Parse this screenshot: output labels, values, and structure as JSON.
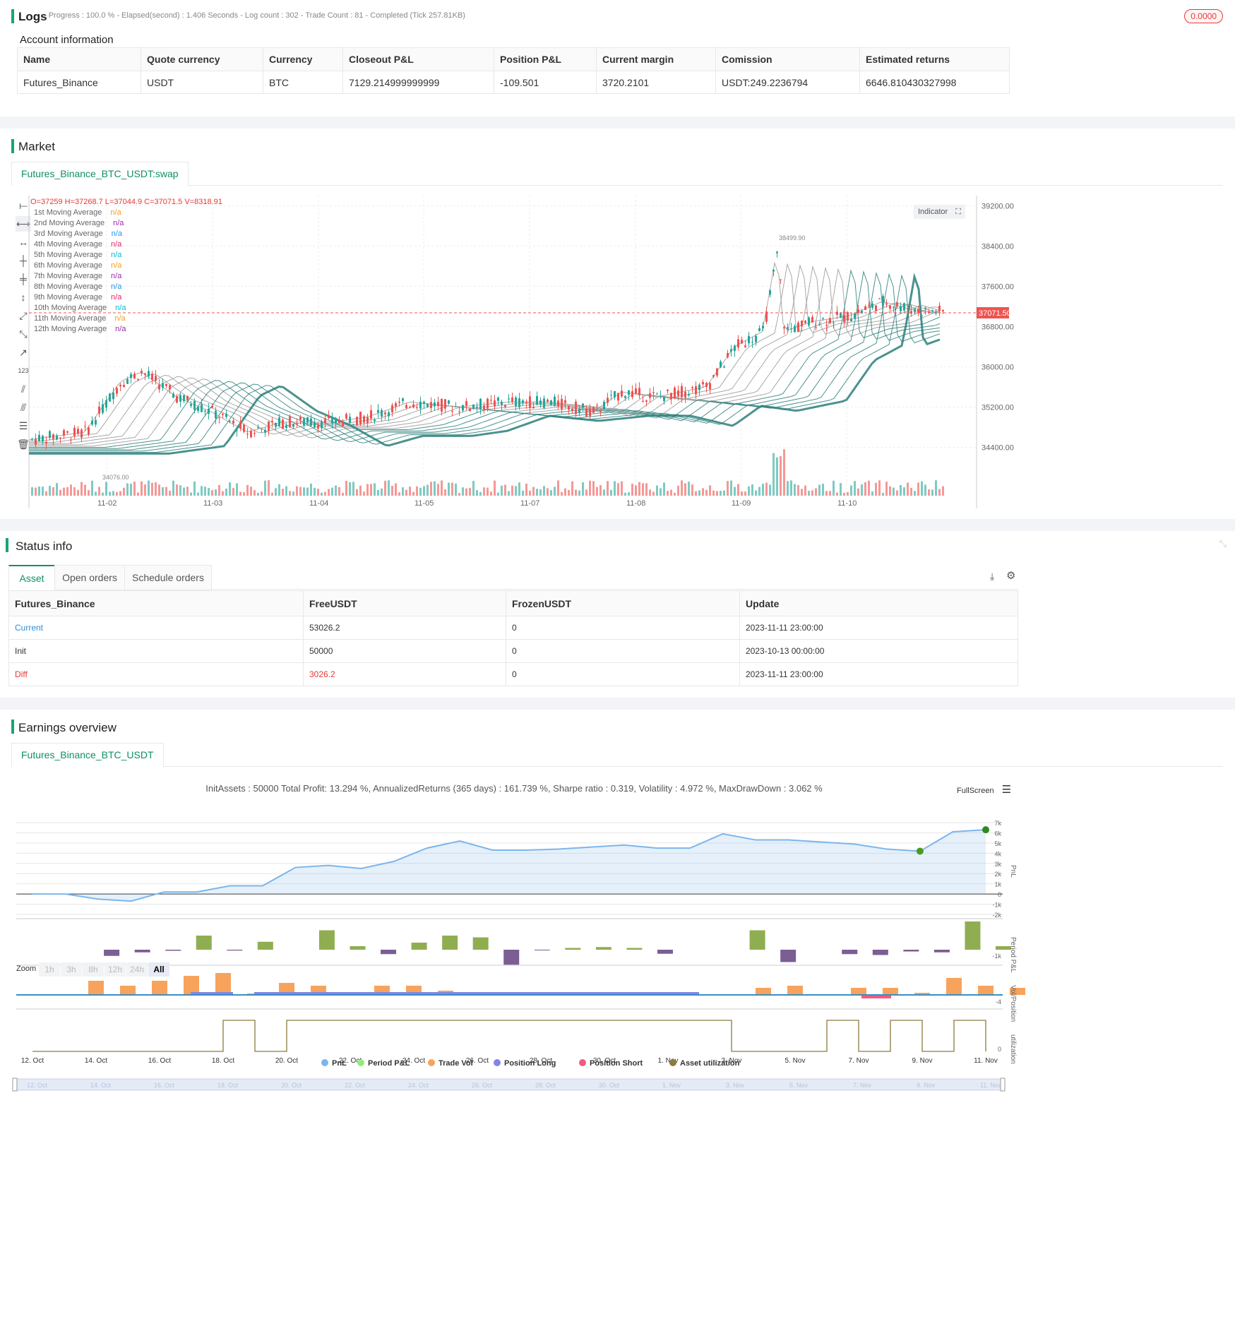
{
  "logs": {
    "title": "Logs",
    "summary": "- Progress : 100.0 % - Elapsed(second) : 1.406 Seconds - Log count : 302 - Trade Count : 81 - Completed (Tick 257.81KB)",
    "badge": "0.0000"
  },
  "account": {
    "title": "Account information",
    "headers": [
      "Name",
      "Quote currency",
      "Currency",
      "Closeout P&L",
      "Position P&L",
      "Current margin",
      "Comission",
      "Estimated returns"
    ],
    "row": [
      "Futures_Binance",
      "USDT",
      "BTC",
      "7129.214999999999",
      "-109.501",
      "3720.2101",
      "USDT:249.2236794",
      "6646.810430327998"
    ]
  },
  "market": {
    "title": "Market",
    "tab": "Futures_Binance_BTC_USDT:swap",
    "ohlc": "O=37259 H=37268.7 L=37044.9 C=37071.5 V=8318.91",
    "indicator_btn": "Indicator",
    "legend": [
      {
        "name": "1st Moving Average",
        "value": "n/a",
        "color": "#f0a020"
      },
      {
        "name": "2nd Moving Average",
        "value": "n/a",
        "color": "#9c27b0"
      },
      {
        "name": "3rd Moving Average",
        "value": "n/a",
        "color": "#2196f3"
      },
      {
        "name": "4th Moving Average",
        "value": "n/a",
        "color": "#e91e63"
      },
      {
        "name": "5th Moving Average",
        "value": "n/a",
        "color": "#00bcd4"
      },
      {
        "name": "6th Moving Average",
        "value": "n/a",
        "color": "#f0a020"
      },
      {
        "name": "7th Moving Average",
        "value": "n/a",
        "color": "#9c27b0"
      },
      {
        "name": "8th Moving Average",
        "value": "n/a",
        "color": "#2196f3"
      },
      {
        "name": "9th Moving Average",
        "value": "n/a",
        "color": "#e91e63"
      },
      {
        "name": "10th Moving Average",
        "value": "n/a",
        "color": "#00bcd4"
      },
      {
        "name": "11th Moving Average",
        "value": "n/a",
        "color": "#f0a020"
      },
      {
        "name": "12th Moving Average",
        "value": "n/a",
        "color": "#9c27b0"
      }
    ],
    "price_axis": [
      "39200.00",
      "38400.00",
      "37600.00",
      "36800.00",
      "36000.00",
      "35200.00",
      "34400.00"
    ],
    "last_price": "37071.50",
    "high_label": "38499.90",
    "low_label": "34076.00",
    "date_axis": [
      "11-02",
      "11-03",
      "11-04",
      "11-05",
      "11-07",
      "11-08",
      "11-09",
      "11-10"
    ]
  },
  "status": {
    "title": "Status info",
    "tabs": [
      "Asset",
      "Open orders",
      "Schedule orders"
    ],
    "headers": [
      "Futures_Binance",
      "FreeUSDT",
      "FrozenUSDT",
      "Update"
    ],
    "rows": [
      [
        "Current",
        "53026.2",
        "0",
        "2023-11-11 23:00:00"
      ],
      [
        "Init",
        "50000",
        "0",
        "2023-10-13 00:00:00"
      ],
      [
        "Diff",
        "3026.2",
        "0",
        "2023-11-11 23:00:00"
      ]
    ]
  },
  "earnings": {
    "title": "Earnings overview",
    "tab": "Futures_Binance_BTC_USDT",
    "summary": "InitAssets : 50000 Total Profit: 13.294 %, AnnualizedReturns (365 days) : 161.739 %, Sharpe ratio : 0.319, Volatility : 4.972 %, MaxDrawDown : 3.062 %",
    "fullscreen": "FullScreen",
    "zoom_label": "Zoom",
    "zoom_buttons": [
      "1h",
      "3h",
      "8h",
      "12h",
      "24h",
      "All"
    ],
    "pnl_axis": [
      "7k",
      "6k",
      "5k",
      "4k",
      "3k",
      "2k",
      "1k",
      "0",
      "-1k",
      "-2k"
    ],
    "period_axis": [
      "-1k"
    ],
    "vol_axis": [
      "-4"
    ],
    "util_axis": [
      "0"
    ],
    "panel_labels": [
      "PnL",
      "Period P&L",
      "Vol/Position",
      "utilization"
    ],
    "date_axis": [
      "12. Oct",
      "14. Oct",
      "16. Oct",
      "18. Oct",
      "20. Oct",
      "22. Oct",
      "24. Oct",
      "26. Oct",
      "28. Oct",
      "30. Oct",
      "1. Nov",
      "3. Nov",
      "5. Nov",
      "7. Nov",
      "9. Nov",
      "11. Nov"
    ],
    "legend": [
      {
        "name": "PnL",
        "color": "#7cb5ec"
      },
      {
        "name": "Period P&L",
        "color": "#90ed7d"
      },
      {
        "name": "Trade Vol",
        "color": "#f7a35c"
      },
      {
        "name": "Position Long",
        "color": "#8085e9"
      },
      {
        "name": "Position Short",
        "color": "#f15c80"
      },
      {
        "name": "Asset utilization",
        "color": "#8d7a3c"
      }
    ]
  },
  "chart_data": [
    {
      "type": "line",
      "title": "",
      "series": [
        {
          "name": "PnL",
          "values": [
            0,
            0,
            -500,
            -700,
            200,
            200,
            800,
            800,
            2600,
            2800,
            2500,
            3200,
            4500,
            5200,
            4300,
            4300,
            4400,
            4600,
            4800,
            4500,
            4500,
            5900,
            5300,
            5300,
            5100,
            4900,
            4400,
            4200,
            6100,
            6300
          ]
        }
      ],
      "ylim": [
        -2000,
        7000
      ]
    },
    {
      "type": "bar",
      "title": "",
      "series": [
        {
          "name": "Period P&L",
          "values": [
            0,
            0,
            -350,
            -150,
            -60,
            800,
            -50,
            450,
            0,
            1100,
            200,
            -250,
            400,
            800,
            700,
            -850,
            -30,
            100,
            150,
            100,
            -230,
            0,
            0,
            1100,
            -700,
            0,
            -250,
            -300,
            -100,
            -150,
            1600,
            200
          ]
        }
      ]
    },
    {
      "type": "bar",
      "title": "",
      "series": [
        {
          "name": "Trade Vol",
          "values": [
            0,
            2,
            1.3,
            2,
            2.7,
            3.1,
            0.2,
            1.7,
            1.3,
            0,
            1.3,
            1.3,
            0.6,
            0,
            0,
            0,
            0,
            0,
            0,
            0,
            0,
            0,
            1,
            1.3,
            0,
            1,
            1,
            0.3,
            2.4,
            1.3,
            1
          ]
        }
      ]
    },
    {
      "type": "line",
      "title": "",
      "series": [
        {
          "name": "Asset utilization",
          "values": [
            0,
            0,
            0,
            0,
            0,
            0,
            1,
            0,
            1,
            1,
            1,
            1,
            1,
            1,
            1,
            1,
            1,
            1,
            1,
            1,
            1,
            1,
            0,
            0,
            0,
            1,
            0,
            1,
            0,
            1,
            0
          ]
        }
      ]
    }
  ]
}
